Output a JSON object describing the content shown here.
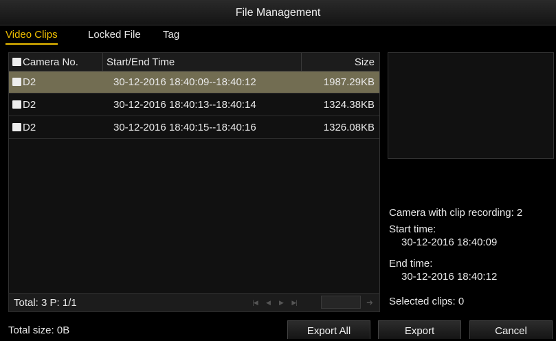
{
  "window": {
    "title": "File Management"
  },
  "tabs": [
    {
      "label": "Video Clips",
      "active": true
    },
    {
      "label": "Locked File",
      "active": false
    },
    {
      "label": "Tag",
      "active": false
    }
  ],
  "table": {
    "columns": [
      "Camera No.",
      "Start/End Time",
      "Size"
    ],
    "rows": [
      {
        "camera": "D2",
        "time": "30-12-2016 18:40:09--18:40:12",
        "size": "1987.29KB",
        "selected": true
      },
      {
        "camera": "D2",
        "time": "30-12-2016 18:40:13--18:40:14",
        "size": "1324.38KB",
        "selected": false
      },
      {
        "camera": "D2",
        "time": "30-12-2016 18:40:15--18:40:16",
        "size": "1326.08KB",
        "selected": false
      }
    ]
  },
  "footer": {
    "summary": "Total: 3  P: 1/1"
  },
  "info": {
    "camera_with_clip": "Camera with clip recording: 2",
    "start_label": "Start time:",
    "start_value": "30-12-2016 18:40:09",
    "end_label": "End time:",
    "end_value": "30-12-2016 18:40:12",
    "selected_clips": "Selected clips: 0"
  },
  "bottom": {
    "total_size": "Total size: 0B",
    "export_all": "Export All",
    "export": "Export",
    "cancel": "Cancel"
  },
  "icons": {
    "pager": [
      "first-page-icon",
      "prev-page-icon",
      "next-page-icon",
      "last-page-icon",
      "go-icon"
    ]
  },
  "colors": {
    "accent": "#f0c000",
    "selected_row": "#726d52"
  }
}
